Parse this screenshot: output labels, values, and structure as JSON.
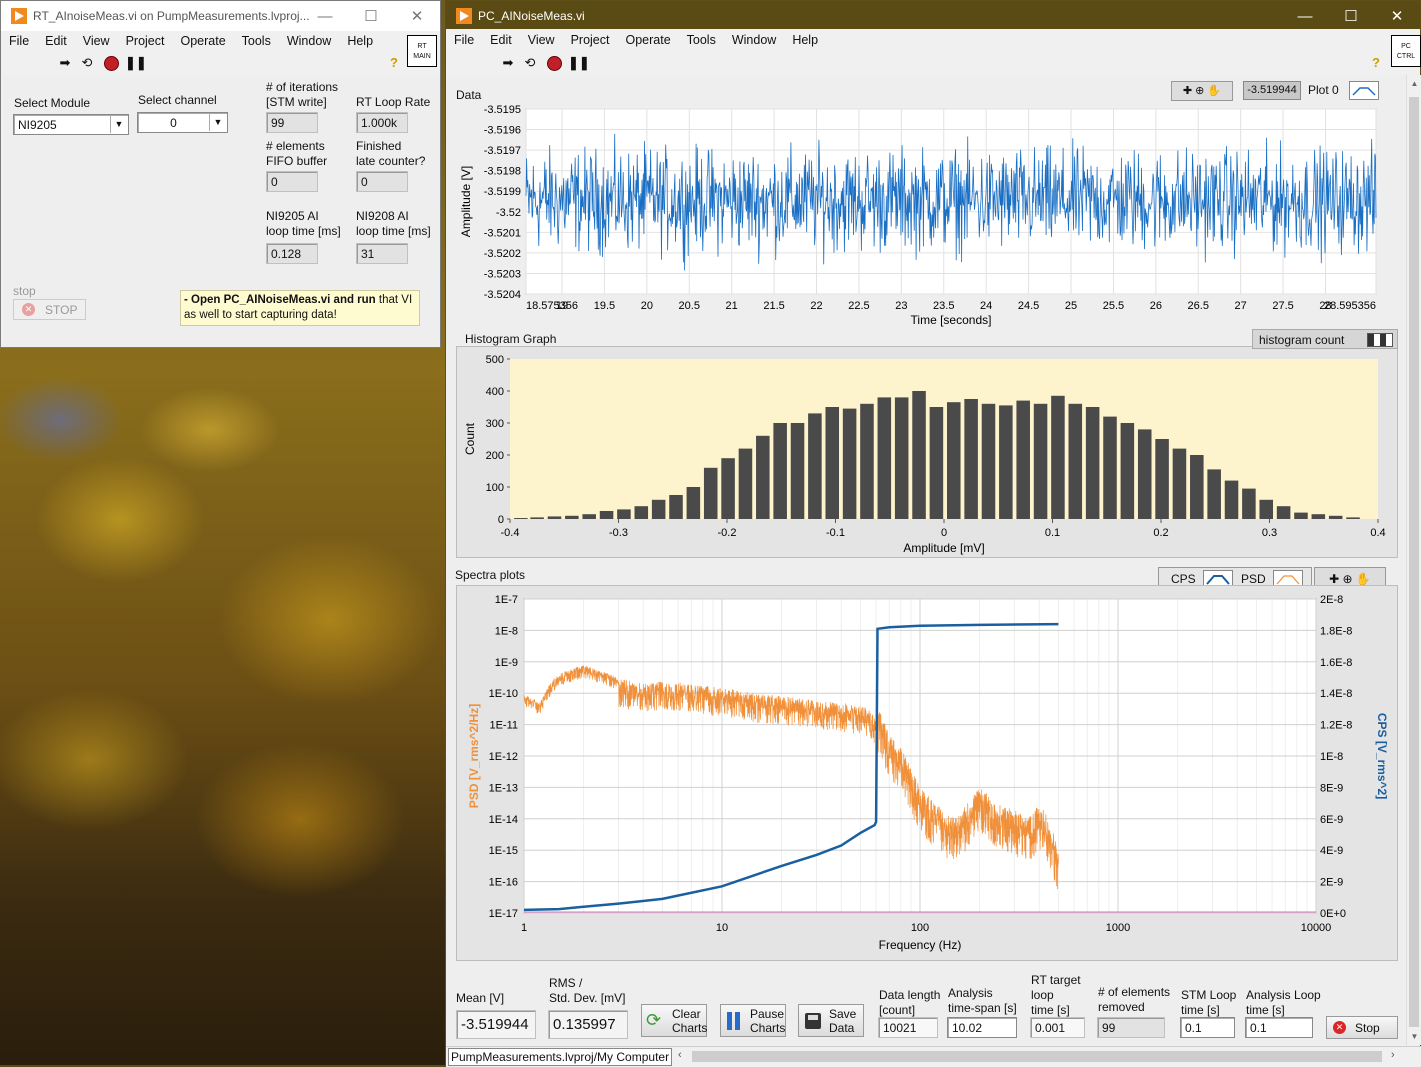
{
  "rt_window": {
    "title": "RT_AInoiseMeas.vi on PumpMeasurements.lvproj...",
    "menu": [
      "File",
      "Edit",
      "View",
      "Project",
      "Operate",
      "Tools",
      "Window",
      "Help"
    ],
    "corner_icon_text": "RT MAIN",
    "select_module_label": "Select Module",
    "select_module_value": "NI9205",
    "select_channel_label": "Select channel",
    "select_channel_value": "0",
    "iterations_label_1": "# of iterations",
    "iterations_label_2": "[STM write]",
    "iterations_value": "99",
    "loop_rate_label": "RT Loop Rate",
    "loop_rate_value": "1.000k",
    "fifo_label_1": "# elements",
    "fifo_label_2": "FIFO buffer",
    "fifo_value": "0",
    "late_label_1": "Finished",
    "late_label_2": "late counter?",
    "late_value": "0",
    "ni9205_label_1": "NI9205 AI",
    "ni9205_label_2": "loop time [ms]",
    "ni9205_value": "0.128",
    "ni9208_label_1": "NI9208 AI",
    "ni9208_label_2": "loop time [ms]",
    "ni9208_value": "31",
    "stop_caption": "stop",
    "stop_button": "STOP",
    "note_bold": "- Open PC_AINoiseMeas.vi and run",
    "note_rest_1": " that VI",
    "note_rest_2": "as well to start capturing data!"
  },
  "pc_window": {
    "title": "PC_AINoiseMeas.vi",
    "menu": [
      "File",
      "Edit",
      "View",
      "Project",
      "Operate",
      "Tools",
      "Window",
      "Help"
    ],
    "corner_icon_text": "PC CTRL",
    "data_graph": {
      "label": "Data",
      "cursor_value": "-3.519944",
      "plot_legend": "Plot 0",
      "y_axis_label": "Amplitude [V]",
      "x_axis_label": "Time [seconds]",
      "y_ticks": [
        "-3.5195",
        "-3.5196",
        "-3.5197",
        "-3.5198",
        "-3.5199",
        "-3.52",
        "-3.5201",
        "-3.5202",
        "-3.5203",
        "-3.5204"
      ],
      "x_ticks": [
        "18.575356",
        "19",
        "19.5",
        "20",
        "20.5",
        "21",
        "21.5",
        "22",
        "22.5",
        "23",
        "23.5",
        "24",
        "24.5",
        "25",
        "25.5",
        "26",
        "26.5",
        "27",
        "27.5",
        "28",
        "28.595356"
      ]
    },
    "histogram": {
      "label": "Histogram Graph",
      "legend": "histogram count",
      "y_axis_label": "Count",
      "x_axis_label": "Amplitude [mV]",
      "y_ticks": [
        "500",
        "400",
        "300",
        "200",
        "100",
        "0"
      ],
      "x_ticks": [
        "-0.4",
        "-0.3",
        "-0.2",
        "-0.1",
        "0",
        "0.1",
        "0.2",
        "0.3",
        "0.4"
      ]
    },
    "spectra": {
      "label": "Spectra plots",
      "legend_cps": "CPS",
      "legend_psd": "PSD",
      "left_axis_label": "PSD [V_rms^2/Hz]",
      "right_axis_label": "CPS [V_rms^2]",
      "x_axis_label": "Frequency (Hz)",
      "left_ticks": [
        "1E-7",
        "1E-8",
        "1E-9",
        "1E-10",
        "1E-11",
        "1E-12",
        "1E-13",
        "1E-14",
        "1E-15",
        "1E-16",
        "1E-17"
      ],
      "right_ticks": [
        "2E-8",
        "1.8E-8",
        "1.6E-8",
        "1.4E-8",
        "1.2E-8",
        "1E-8",
        "8E-9",
        "6E-9",
        "4E-9",
        "2E-9",
        "0E+0"
      ],
      "x_ticks": [
        "1",
        "10",
        "100",
        "1000",
        "10000"
      ]
    },
    "bottom": {
      "mean_label": "Mean [V]",
      "mean_value": "-3.519944",
      "rms_label_1": "RMS /",
      "rms_label_2": "Std. Dev. [mV]",
      "rms_value": "0.135997",
      "clear_1": "Clear",
      "clear_2": "Charts",
      "pause_1": "Pause",
      "pause_2": "Charts",
      "save_1": "Save",
      "save_2": "Data",
      "data_length_label_1": "Data length",
      "data_length_label_2": "[count]",
      "data_length_value": "10021",
      "analysis_span_label_1": "Analysis",
      "analysis_span_label_2": "time-span [s]",
      "analysis_span_value": "10.02",
      "rt_target_label_1": "RT target",
      "rt_target_label_2": "loop",
      "rt_target_label_3": "time [s]",
      "rt_target_value": "0.001",
      "removed_label_1": "# of elements",
      "removed_label_2": "removed",
      "removed_value": "99",
      "stm_label_1": "STM Loop",
      "stm_label_2": "time [s]",
      "stm_value": "0.1",
      "analysis_loop_label_1": "Analysis Loop",
      "analysis_loop_label_2": "time [s]",
      "analysis_loop_value": "0.1",
      "stop_button": "Stop"
    },
    "status_path": "PumpMeasurements.lvproj/My Computer"
  },
  "chart_data": [
    {
      "type": "line",
      "title": "Data",
      "xlabel": "Time [seconds]",
      "ylabel": "Amplitude [V]",
      "xlim": [
        18.575356,
        28.595356
      ],
      "ylim": [
        -3.5204,
        -3.5195
      ],
      "series": [
        {
          "name": "Plot 0",
          "color": "#1a6fc4",
          "description_mean": -3.519944
        }
      ]
    },
    {
      "type": "bar",
      "title": "Histogram Graph",
      "xlabel": "Amplitude [mV]",
      "ylabel": "Count",
      "xlim": [
        -0.4,
        0.4
      ],
      "ylim": [
        0,
        500
      ],
      "bin_centers": [
        -0.39,
        -0.375,
        -0.359,
        -0.343,
        -0.327,
        -0.311,
        -0.295,
        -0.279,
        -0.263,
        -0.247,
        -0.231,
        -0.215,
        -0.199,
        -0.183,
        -0.167,
        -0.151,
        -0.135,
        -0.119,
        -0.103,
        -0.087,
        -0.071,
        -0.055,
        -0.039,
        -0.023,
        -0.007,
        0.009,
        0.025,
        0.041,
        0.057,
        0.073,
        0.089,
        0.105,
        0.121,
        0.137,
        0.153,
        0.169,
        0.185,
        0.201,
        0.217,
        0.233,
        0.249,
        0.265,
        0.281,
        0.297,
        0.313,
        0.329,
        0.345,
        0.361,
        0.377
      ],
      "values": [
        3,
        5,
        8,
        10,
        15,
        25,
        30,
        40,
        60,
        75,
        100,
        160,
        190,
        220,
        260,
        300,
        300,
        330,
        350,
        345,
        360,
        380,
        380,
        400,
        350,
        365,
        375,
        360,
        355,
        370,
        360,
        385,
        360,
        350,
        320,
        300,
        280,
        250,
        220,
        200,
        155,
        120,
        95,
        60,
        40,
        20,
        15,
        10,
        5
      ],
      "series": [
        {
          "name": "histogram count",
          "color": "#4a4a4a"
        }
      ]
    },
    {
      "type": "line",
      "title": "Spectra plots",
      "xlabel": "Frequency (Hz)",
      "x_scale": "log",
      "xlim": [
        1,
        10000
      ],
      "left_axis": {
        "label": "PSD [V_rms^2/Hz]",
        "scale": "log",
        "ylim": [
          1e-17,
          1e-07
        ]
      },
      "right_axis": {
        "label": "CPS [V_rms^2]",
        "scale": "linear",
        "ylim": [
          0,
          2e-08
        ]
      },
      "series": [
        {
          "name": "PSD",
          "axis": "left",
          "color": "#f0903a",
          "x": [
            1,
            1.2,
            1.4,
            1.6,
            2,
            2.5,
            3,
            4,
            5,
            7,
            10,
            15,
            20,
            30,
            40,
            50,
            55,
            60,
            62,
            70,
            80,
            100,
            120,
            150,
            200,
            250,
            300,
            350,
            400,
            450,
            500
          ],
          "y": [
            1e-10,
            5e-11,
            3e-10,
            5e-10,
            8e-10,
            5e-10,
            3e-10,
            2e-10,
            2.5e-10,
            2e-10,
            1.5e-10,
            1e-10,
            8e-11,
            6e-11,
            5e-11,
            4e-11,
            3e-11,
            2e-11,
            3e-11,
            5e-12,
            2e-12,
            1e-13,
            3e-14,
            1e-14,
            1e-13,
            3e-14,
            2e-14,
            1e-14,
            3e-14,
            1e-14,
            1e-15
          ]
        },
        {
          "name": "CPS",
          "axis": "right",
          "color": "#1a5fa0",
          "x": [
            1,
            1.5,
            2,
            3,
            5,
            10,
            20,
            30,
            40,
            50,
            59,
            60,
            61,
            70,
            100,
            200,
            500
          ],
          "y": [
            2e-10,
            2.5e-10,
            4e-10,
            6e-10,
            9e-10,
            1.7e-09,
            3e-09,
            3.7e-09,
            4.3e-09,
            5.1e-09,
            5.6e-09,
            5.8e-09,
            1.81e-08,
            1.82e-08,
            1.83e-08,
            1.835e-08,
            1.84e-08
          ]
        }
      ]
    }
  ],
  "colors": {
    "data_trace": "#1a6fc4",
    "histogram_bg": "#fdf3cc",
    "histogram_bar": "#4a4a4a",
    "psd": "#f0903a",
    "cps": "#1a5fa0",
    "note_bg": "#fffbd0"
  }
}
